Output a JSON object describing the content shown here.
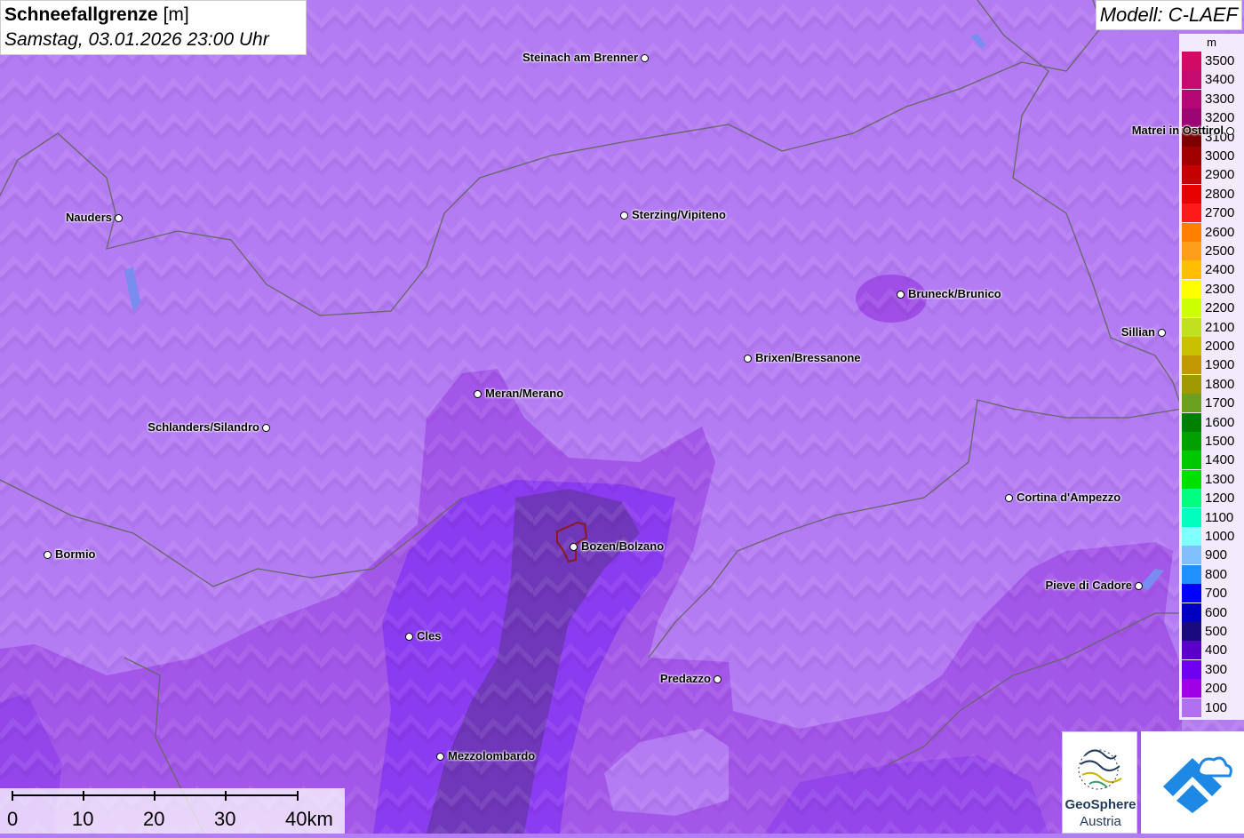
{
  "title": {
    "name": "Schneefallgrenze",
    "unit": "[m]",
    "datetime": "Samstag, 03.01.2026 23:00 Uhr"
  },
  "model_label": "Modell: C-LAEF",
  "legend": {
    "unit": "m",
    "items": [
      {
        "label": "3500",
        "color": "#d10a63"
      },
      {
        "label": "3400",
        "color": "#c50b6f"
      },
      {
        "label": "3300",
        "color": "#b30876"
      },
      {
        "label": "3200",
        "color": "#9b0574"
      },
      {
        "label": "3100",
        "color": "#7b0000"
      },
      {
        "label": "3000",
        "color": "#a00000"
      },
      {
        "label": "2900",
        "color": "#c40000"
      },
      {
        "label": "2800",
        "color": "#e60000"
      },
      {
        "label": "2700",
        "color": "#ff1a1a"
      },
      {
        "label": "2600",
        "color": "#ff7f00"
      },
      {
        "label": "2500",
        "color": "#ff9e1a"
      },
      {
        "label": "2400",
        "color": "#ffbf00"
      },
      {
        "label": "2300",
        "color": "#ffff00"
      },
      {
        "label": "2200",
        "color": "#ccff00"
      },
      {
        "label": "2100",
        "color": "#c0e020"
      },
      {
        "label": "2000",
        "color": "#c8c000"
      },
      {
        "label": "1900",
        "color": "#c09a00"
      },
      {
        "label": "1800",
        "color": "#a09a00"
      },
      {
        "label": "1700",
        "color": "#6ca020"
      },
      {
        "label": "1600",
        "color": "#008000"
      },
      {
        "label": "1500",
        "color": "#00a000"
      },
      {
        "label": "1400",
        "color": "#00c800"
      },
      {
        "label": "1300",
        "color": "#00e000"
      },
      {
        "label": "1200",
        "color": "#00ff80"
      },
      {
        "label": "1100",
        "color": "#00ffbf"
      },
      {
        "label": "1000",
        "color": "#80ffff"
      },
      {
        "label": "900",
        "color": "#80c0ff"
      },
      {
        "label": "800",
        "color": "#2090ff"
      },
      {
        "label": "700",
        "color": "#0000ff"
      },
      {
        "label": "600",
        "color": "#0000c0"
      },
      {
        "label": "500",
        "color": "#1a0a80"
      },
      {
        "label": "400",
        "color": "#5a00c8"
      },
      {
        "label": "300",
        "color": "#7000f0"
      },
      {
        "label": "200",
        "color": "#a000e6"
      },
      {
        "label": "100",
        "color": "#b070f0"
      }
    ]
  },
  "cities": [
    {
      "name": "Steinach am Brenner",
      "side": "left"
    },
    {
      "name": "Matrei in Osttirol",
      "side": "left"
    },
    {
      "name": "Nauders",
      "side": "left"
    },
    {
      "name": "Sterzing/Vipiteno",
      "side": "right"
    },
    {
      "name": "Bruneck/Brunico",
      "side": "right"
    },
    {
      "name": "Sillian",
      "side": "left"
    },
    {
      "name": "Brixen/Bressanone",
      "side": "right"
    },
    {
      "name": "Meran/Merano",
      "side": "right"
    },
    {
      "name": "Schlanders/Silandro",
      "side": "left"
    },
    {
      "name": "Cortina d'Ampezzo",
      "side": "right"
    },
    {
      "name": "Bozen/Bolzano",
      "side": "right"
    },
    {
      "name": "Bormio",
      "side": "right"
    },
    {
      "name": "Pieve di Cadore",
      "side": "left"
    },
    {
      "name": "Cles",
      "side": "right"
    },
    {
      "name": "Predazzo",
      "side": "left"
    },
    {
      "name": "Mezzolombardo",
      "side": "right"
    }
  ],
  "scalebar": {
    "labels": [
      "0",
      "10",
      "20",
      "30",
      "40km"
    ]
  },
  "logos": {
    "geosphere_line1": "GeoSphere",
    "geosphere_line2": "Austria"
  }
}
